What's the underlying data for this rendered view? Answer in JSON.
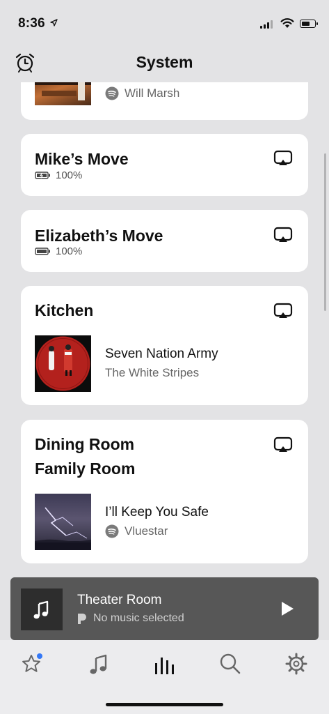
{
  "status_bar": {
    "time": "8:36"
  },
  "header": {
    "title": "System"
  },
  "rooms": [
    {
      "name": "",
      "source_label": "Will Marsh"
    },
    {
      "name": "Mike’s Move",
      "battery_text": "100%"
    },
    {
      "name": "Elizabeth’s Move",
      "battery_text": "100%"
    },
    {
      "name": "Kitchen",
      "track": "Seven Nation Army",
      "artist": "The White Stripes"
    },
    {
      "name_line1": "Dining Room",
      "name_line2": "Family Room",
      "track": "I’ll Keep You Safe",
      "artist": "Vluestar"
    }
  ],
  "mini_player": {
    "room": "Theater Room",
    "status": "No music selected"
  },
  "tabs": [
    "favorites",
    "browse",
    "system",
    "search",
    "settings"
  ],
  "colors": {
    "background": "#e3e3e5",
    "card": "#ffffff",
    "mini_player": "#575757",
    "badge": "#3478f6"
  }
}
